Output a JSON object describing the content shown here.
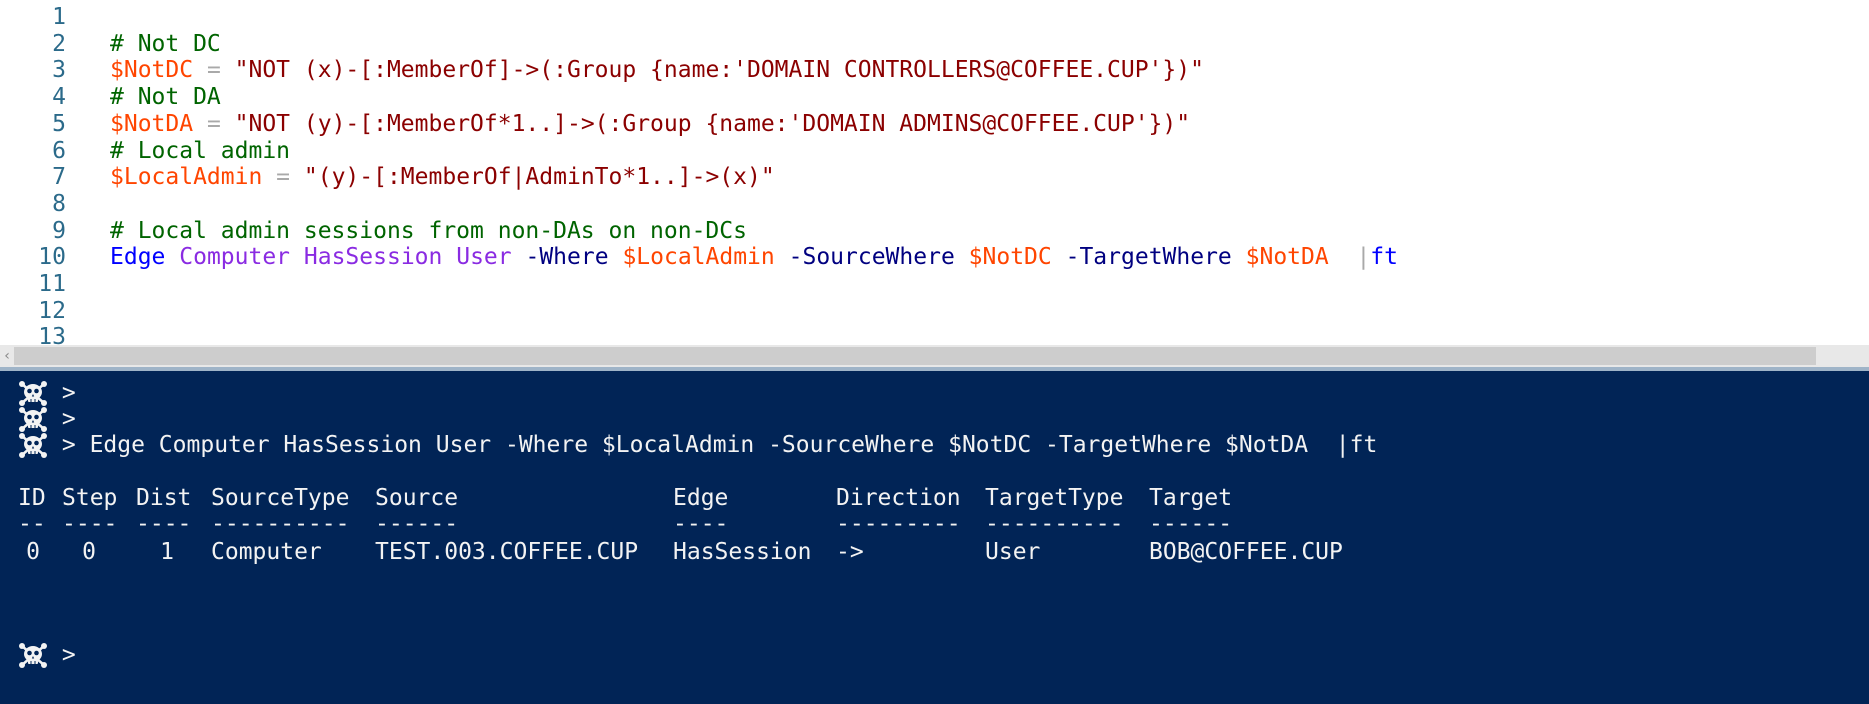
{
  "editor": {
    "lines": [
      {
        "n": "1",
        "tokens": []
      },
      {
        "n": "2",
        "tokens": [
          {
            "t": "comment",
            "v": "# Not DC"
          }
        ]
      },
      {
        "n": "3",
        "tokens": [
          {
            "t": "var",
            "v": "$NotDC"
          },
          {
            "t": "op",
            "v": " = "
          },
          {
            "t": "str",
            "v": "\"NOT (x)-[:MemberOf]->(:Group {name:'DOMAIN CONTROLLERS@COFFEE.CUP'})\""
          }
        ]
      },
      {
        "n": "4",
        "tokens": [
          {
            "t": "comment",
            "v": "# Not DA"
          }
        ]
      },
      {
        "n": "5",
        "tokens": [
          {
            "t": "var",
            "v": "$NotDA"
          },
          {
            "t": "op",
            "v": " = "
          },
          {
            "t": "str",
            "v": "\"NOT (y)-[:MemberOf*1..]->(:Group {name:'DOMAIN ADMINS@COFFEE.CUP'})\""
          }
        ]
      },
      {
        "n": "6",
        "tokens": [
          {
            "t": "comment",
            "v": "# Local admin"
          }
        ]
      },
      {
        "n": "7",
        "tokens": [
          {
            "t": "var",
            "v": "$LocalAdmin"
          },
          {
            "t": "op",
            "v": " = "
          },
          {
            "t": "str",
            "v": "\"(y)-[:MemberOf|AdminTo*1..]->(x)\""
          }
        ]
      },
      {
        "n": "8",
        "tokens": []
      },
      {
        "n": "9",
        "tokens": [
          {
            "t": "comment",
            "v": "# Local admin sessions from non-DAs on non-DCs"
          }
        ]
      },
      {
        "n": "10",
        "tokens": [
          {
            "t": "cmd",
            "v": "Edge"
          },
          {
            "t": "plain",
            "v": " "
          },
          {
            "t": "arg",
            "v": "Computer"
          },
          {
            "t": "plain",
            "v": " "
          },
          {
            "t": "arg",
            "v": "HasSession"
          },
          {
            "t": "plain",
            "v": " "
          },
          {
            "t": "arg",
            "v": "User"
          },
          {
            "t": "plain",
            "v": " "
          },
          {
            "t": "param",
            "v": "-Where"
          },
          {
            "t": "plain",
            "v": " "
          },
          {
            "t": "var",
            "v": "$LocalAdmin"
          },
          {
            "t": "plain",
            "v": " "
          },
          {
            "t": "param",
            "v": "-SourceWhere"
          },
          {
            "t": "plain",
            "v": " "
          },
          {
            "t": "var",
            "v": "$NotDC"
          },
          {
            "t": "plain",
            "v": " "
          },
          {
            "t": "param",
            "v": "-TargetWhere"
          },
          {
            "t": "plain",
            "v": " "
          },
          {
            "t": "var",
            "v": "$NotDA"
          },
          {
            "t": "plain",
            "v": "  "
          },
          {
            "t": "pipe",
            "v": "|"
          },
          {
            "t": "cmd",
            "v": "ft"
          }
        ]
      },
      {
        "n": "11",
        "tokens": []
      },
      {
        "n": "12",
        "tokens": []
      },
      {
        "n": "13",
        "tokens": []
      }
    ]
  },
  "console": {
    "prompt": ">",
    "prompt_icon": "skull-icon",
    "lines": [
      {
        "cmd": ""
      },
      {
        "cmd": ""
      },
      {
        "cmd": " Edge Computer HasSession User -Where $LocalAdmin -SourceWhere $NotDC -TargetWhere $NotDA  |ft"
      }
    ],
    "table": {
      "headers": [
        "ID",
        "Step",
        "Dist",
        "SourceType",
        "Source",
        "Edge",
        "Direction",
        "TargetType",
        "Target"
      ],
      "underlines": [
        "--",
        "----",
        "----",
        "----------",
        "------",
        "----",
        "---------",
        "----------",
        "------"
      ],
      "rows": [
        [
          "0",
          "0",
          "1",
          "Computer",
          "TEST.003.COFFEE.CUP",
          "HasSession",
          "->",
          "User",
          "BOB@COFFEE.CUP"
        ]
      ]
    },
    "final_prompt": ">"
  },
  "colors": {
    "console_bg": "#012456",
    "comment": "#006400",
    "variable": "#ff4500",
    "string": "#8b0000",
    "command": "#0000ff",
    "argument": "#8a2be2",
    "parameter": "#000080"
  }
}
